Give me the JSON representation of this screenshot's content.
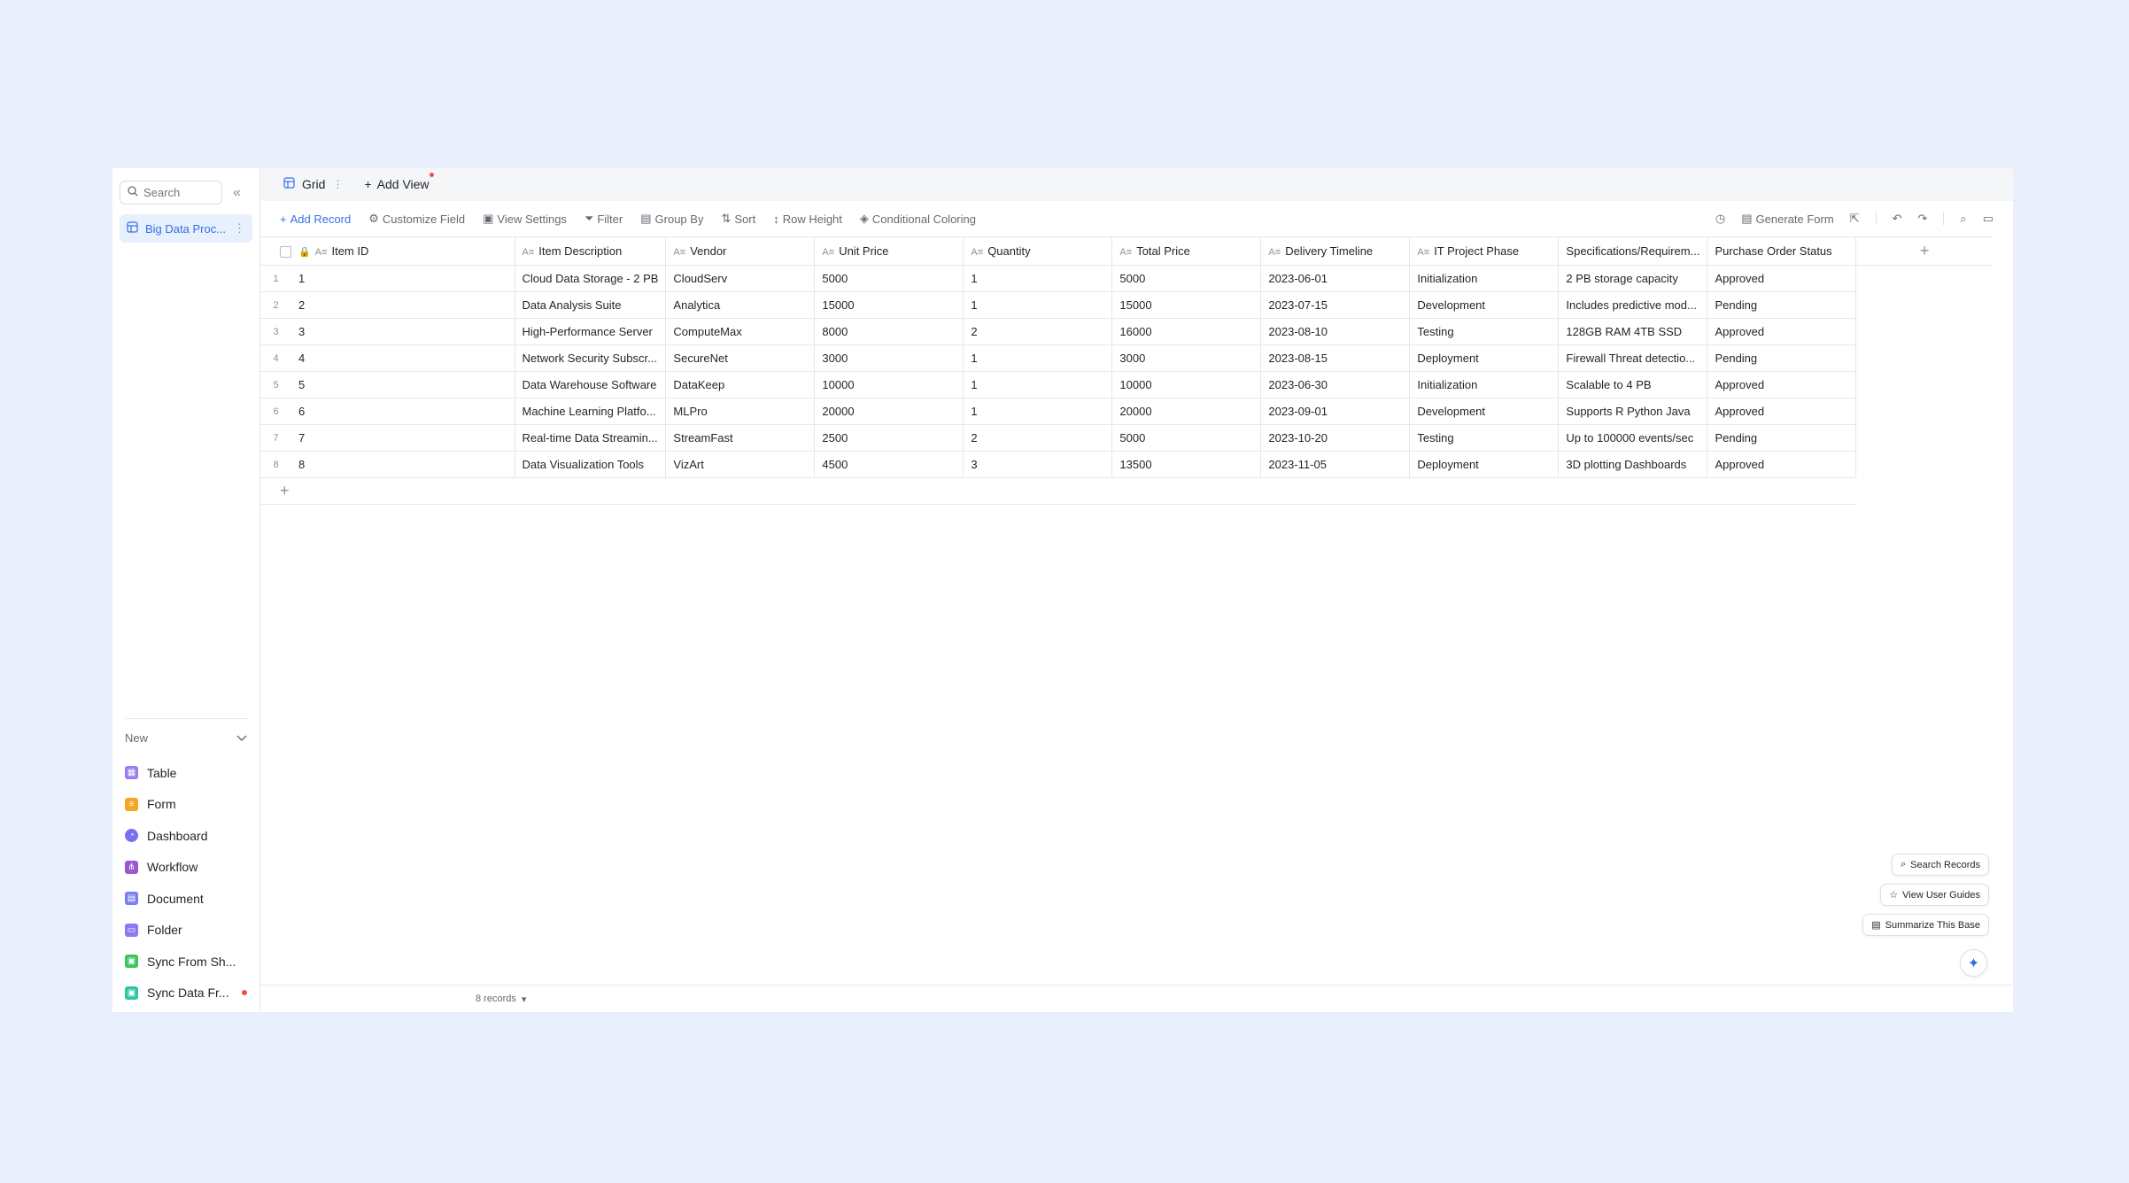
{
  "sidebar": {
    "search_placeholder": "Search",
    "base_name": "Big Data Proc...",
    "new_label": "New",
    "new_items": [
      {
        "label": "Table",
        "icon": "table-icon",
        "color": "#9b7bf2"
      },
      {
        "label": "Form",
        "icon": "form-icon",
        "color": "#f5a623"
      },
      {
        "label": "Dashboard",
        "icon": "dashboard-icon",
        "color": "#7a6ff0"
      },
      {
        "label": "Workflow",
        "icon": "workflow-icon",
        "color": "#9b59d0"
      },
      {
        "label": "Document",
        "icon": "document-icon",
        "color": "#7a7ff0"
      },
      {
        "label": "Folder",
        "icon": "folder-icon",
        "color": "#8b7bf2"
      },
      {
        "label": "Sync From Sh...",
        "icon": "sync-sheet-icon",
        "color": "#34c759"
      },
      {
        "label": "Sync Data Fr...",
        "icon": "sync-data-icon",
        "color": "#2ec4a6"
      }
    ]
  },
  "tabs": {
    "grid_label": "Grid",
    "add_view_label": "Add View"
  },
  "toolbar": {
    "add_record": "Add Record",
    "customize_field": "Customize Field",
    "view_settings": "View Settings",
    "filter": "Filter",
    "group_by": "Group By",
    "sort": "Sort",
    "row_height": "Row Height",
    "conditional_coloring": "Conditional Coloring",
    "generate_form": "Generate Form"
  },
  "table": {
    "columns": [
      "Item ID",
      "Item Description",
      "Vendor",
      "Unit Price",
      "Quantity",
      "Total Price",
      "Delivery Timeline",
      "IT Project Phase",
      "Specifications/Requirem...",
      "Purchase Order Status"
    ],
    "rows": [
      [
        "1",
        "Cloud Data Storage - 2 PB",
        "CloudServ",
        "5000",
        "1",
        "5000",
        "2023-06-01",
        "Initialization",
        "2 PB storage capacity",
        "Approved"
      ],
      [
        "2",
        "Data Analysis Suite",
        "Analytica",
        "15000",
        "1",
        "15000",
        "2023-07-15",
        "Development",
        "Includes predictive mod...",
        "Pending"
      ],
      [
        "3",
        "High-Performance Server",
        "ComputeMax",
        "8000",
        "2",
        "16000",
        "2023-08-10",
        "Testing",
        "128GB RAM 4TB SSD",
        "Approved"
      ],
      [
        "4",
        "Network Security Subscr...",
        "SecureNet",
        "3000",
        "1",
        "3000",
        "2023-08-15",
        "Deployment",
        "Firewall Threat detectio...",
        "Pending"
      ],
      [
        "5",
        "Data Warehouse Software",
        "DataKeep",
        "10000",
        "1",
        "10000",
        "2023-06-30",
        "Initialization",
        "Scalable to 4 PB",
        "Approved"
      ],
      [
        "6",
        "Machine Learning Platfo...",
        "MLPro",
        "20000",
        "1",
        "20000",
        "2023-09-01",
        "Development",
        "Supports R Python Java",
        "Approved"
      ],
      [
        "7",
        "Real-time Data Streamin...",
        "StreamFast",
        "2500",
        "2",
        "5000",
        "2023-10-20",
        "Testing",
        "Up to 100000 events/sec",
        "Pending"
      ],
      [
        "8",
        "Data Visualization Tools",
        "VizArt",
        "4500",
        "3",
        "13500",
        "2023-11-05",
        "Deployment",
        "3D plotting Dashboards",
        "Approved"
      ]
    ]
  },
  "footer": {
    "records_label": "8 records"
  },
  "ai": {
    "search_records": "Search Records",
    "view_user_guides": "View User Guides",
    "summarize_base": "Summarize This Base"
  },
  "colors": {
    "accent": "#3470e4",
    "page_background": "#e9effb",
    "badge_red": "#f54a45"
  }
}
